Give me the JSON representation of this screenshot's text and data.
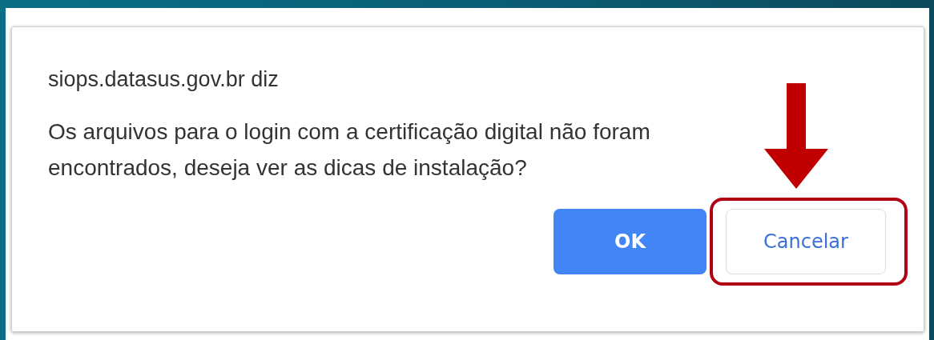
{
  "dialog": {
    "title": "siops.datasus.gov.br diz",
    "message": "Os arquivos para o login com a certificação digital não foram encontrados, deseja ver as dicas de instalação?",
    "buttons": [
      {
        "label": "OK",
        "kind": "primary",
        "highlighted": false
      },
      {
        "label": "Cancelar",
        "kind": "secondary",
        "highlighted": true
      }
    ]
  }
}
